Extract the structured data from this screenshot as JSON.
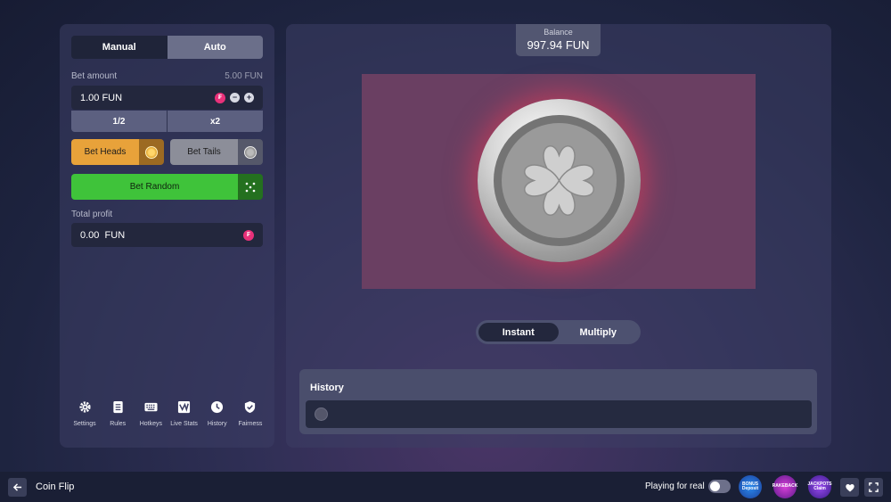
{
  "tabs": {
    "manual": "Manual",
    "auto": "Auto"
  },
  "bet": {
    "label": "Bet amount",
    "max_hint": "5.00 FUN",
    "value": "1.00 FUN",
    "half": "1/2",
    "double": "x2",
    "minus": "−",
    "plus": "+"
  },
  "buttons": {
    "heads": "Bet Heads",
    "tails": "Bet Tails",
    "random": "Bet Random"
  },
  "profit": {
    "label": "Total profit",
    "value": "0.00",
    "currency": "FUN"
  },
  "toolbar": [
    {
      "label": "Settings",
      "icon": "gear-icon"
    },
    {
      "label": "Rules",
      "icon": "document-icon"
    },
    {
      "label": "Hotkeys",
      "icon": "keyboard-icon"
    },
    {
      "label": "Live Stats",
      "icon": "chart-icon"
    },
    {
      "label": "History",
      "icon": "clock-icon"
    },
    {
      "label": "Fairness",
      "icon": "shield-check-icon"
    }
  ],
  "balance": {
    "label": "Balance",
    "value": "997.94 FUN"
  },
  "speed": {
    "instant": "Instant",
    "multiply": "Multiply"
  },
  "history": {
    "title": "History"
  },
  "footer": {
    "title": "Coin Flip",
    "real_label": "Playing for real",
    "real_enabled": false,
    "promos": [
      {
        "top": "BONUS",
        "bottom": "Deposit"
      },
      {
        "top": "RAKEBACK",
        "bottom": ""
      },
      {
        "top": "JACKPOTS",
        "bottom": "Claim"
      }
    ]
  },
  "colors": {
    "heads": "#e8a23a",
    "tails": "#8c8e99",
    "random": "#3fc33a",
    "currency": "#e8317a",
    "stage": "#6a3f62"
  }
}
